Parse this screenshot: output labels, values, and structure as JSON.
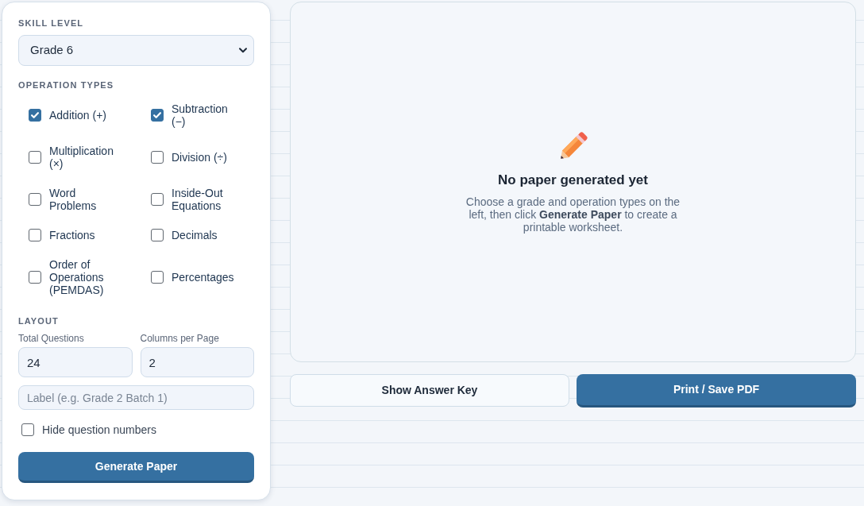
{
  "sidebar": {
    "skill_level": {
      "label": "SKILL LEVEL",
      "select": {
        "value": "Grade 6"
      }
    },
    "operation_types": {
      "label": "OPERATION TYPES",
      "options": [
        {
          "label": "Addition (+)",
          "checked": true
        },
        {
          "label": "Subtraction (−)",
          "checked": true
        },
        {
          "label": "Multiplication (×)",
          "checked": false
        },
        {
          "label": "Division (÷)",
          "checked": false
        },
        {
          "label": "Word Problems",
          "checked": false
        },
        {
          "label": "Inside-Out Equations",
          "checked": false
        },
        {
          "label": "Fractions",
          "checked": false
        },
        {
          "label": "Decimals",
          "checked": false
        },
        {
          "label": "Order of Operations (PEMDAS)",
          "checked": false
        },
        {
          "label": "Percentages",
          "checked": false
        }
      ]
    },
    "layout": {
      "label": "LAYOUT",
      "fields": [
        {
          "label": "Total Questions",
          "value": "24"
        },
        {
          "label": "Columns per Page",
          "value": "2"
        }
      ],
      "label_field": {
        "placeholder": "Label (e.g. Grade 2 Batch 1)"
      },
      "hide_numbers": {
        "label": "Hide question numbers",
        "checked": false
      }
    },
    "generate_button": {
      "label": "Generate Paper"
    }
  },
  "preview": {
    "title": "No paper generated yet",
    "message": "Choose a grade and operation types on the left, then click **Generate Paper** to create a printable worksheet."
  },
  "actions": [
    {
      "label": "Show Answer Key",
      "kind": "secondary"
    },
    {
      "label": "Print / Save PDF",
      "kind": "primary"
    }
  ]
}
